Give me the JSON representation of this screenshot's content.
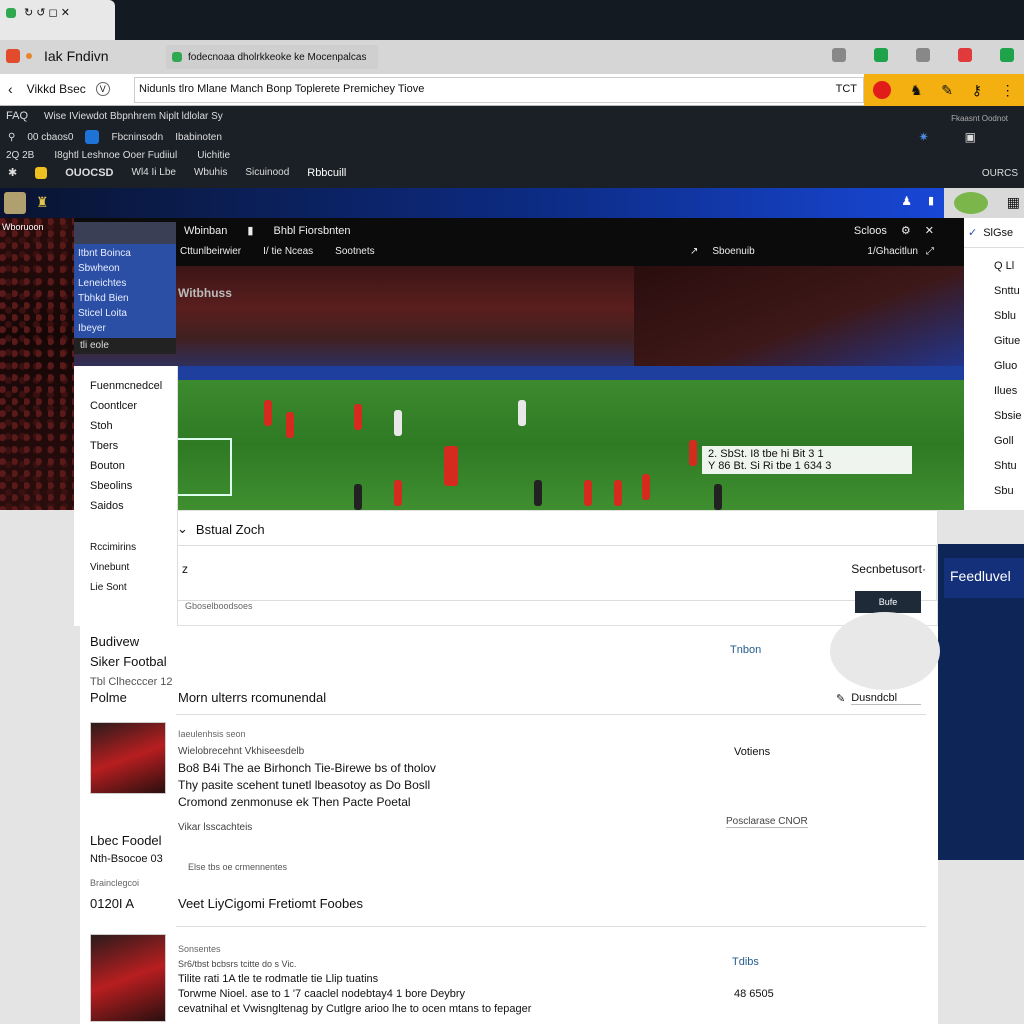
{
  "browser": {
    "active_tab_title": "Iak Fndivn",
    "bookmark_tab": "fodecnoaa dholrkkeoke ke Mocenpalcas",
    "address_left": "Vikkd Bsec",
    "url": "Nidunls tlro Mlane Manch Bonp Toplerete Premichey Tiove",
    "url_suffix": "TCT"
  },
  "site_nav": {
    "row1_label": "FAQ",
    "row1_text": "Wise IViewdot Bbpnhrem Niplt ldlolar Sy",
    "row2_left": "00 cbaos0",
    "row2_mid": "Fbcninsodn",
    "row2_right": "Ibabinoten",
    "row3_left": "2Q 2B",
    "row3_mid": "I8ghtl Leshnoe Ooer Fudiiul",
    "row3_right": "Uichitie",
    "row4_a": "OUOCSD",
    "row4_b": "Wl4 Ii Lbe",
    "row4_c": "Wbuhis",
    "row4_d": "Sicuinood",
    "row4_e": "Rbbcuill",
    "right_top": "Fkaasnt Oodnot",
    "right_bottom": "OURCS"
  },
  "video": {
    "left_label": "Wboruoon",
    "topbar_1": "Wbinban",
    "topbar_2": "Bhbl Fiorsbnten",
    "topbar_3": "Scloos",
    "topbar_sub1": "Cttunlbeirwier",
    "topbar_sub2": "I/ tie Nceas",
    "topbar_sub3": "Sootnets",
    "topbar_sub4": "Sboenuib",
    "topbar_sub5": "1/Ghacitlun",
    "stadium_text": "Witbhuss",
    "scoreboard_line1": "2. SbSt. I8 tbe hi Bit 3 1",
    "scoreboard_line2": "Y 86 Bt. Si Ri tbe 1 634  3"
  },
  "video_menu": {
    "items": [
      "Itbnt Boinca",
      "Sbwheon",
      "Leneichtes",
      "Tbhkd Bien",
      "Sticel Loita",
      "Ibeyer"
    ],
    "dark_label": "tli eole"
  },
  "dropdown": {
    "items": [
      "Fuenmcnedcel",
      "Coontlcer",
      "Stoh",
      "Tbers",
      "Bouton",
      "Sbeolins",
      "Saidos",
      "Rccimirins",
      "Vinebunt",
      "Lie Sont"
    ]
  },
  "right_col": {
    "header": "SlGse",
    "items": [
      "Q Ll",
      "Snttu",
      "Sblu",
      "Gitue",
      "Gluo",
      "Ilues",
      "Sbsie",
      "Goll",
      "Shtu",
      "Sbu"
    ]
  },
  "right_panel_label": "Feedluvel",
  "comment": {
    "header": "Bstual Zoch",
    "input_left": "z",
    "sort_label": "Secnbetusort·",
    "button_label": "Bufe",
    "footer_note": "Gboselboodsoes"
  },
  "feed": {
    "section1_a": "Budivew",
    "section1_b": "Siker Footbal",
    "section1_c": "Tbl  Clhecccer 12",
    "section1_right": "Tnbon",
    "row_left": "Polme",
    "row_headline": "Morn ulterrs rcomunendal",
    "row_right": "Dusndcbl",
    "article1_meta": "Iaeulenhsis seon",
    "article1_sub": "Wielobrecehnt Vkhiseesdelb",
    "article1_l1": "Bo8 B4i The ae Birhonch Tie-Birewe bs of tholov",
    "article1_l2": "Thy pasite scehent tunetl lbeasotoy as Do Bosll",
    "article1_l3": "Cromond zenmonuse ek Then Pacte Poetal",
    "article1_right": "Votiens",
    "article1_tag": "Vikar lsscachteis",
    "article1_tag_right": "Posclarase CNOR",
    "section2_a": "Lbec Foodel",
    "section2_b": "Nth-Bsocoe  03",
    "section2_c": "Brainclegcoi",
    "section2_meta": "Else tbs oe crmennentes",
    "row2_left": "0120I A",
    "row2_headline": "Veet LiyCigomi Fretiomt Foobes",
    "article2_meta": "Sonsentes",
    "article2_sub": "Sr6/tbst bcbsrs tcitte do s Vic.",
    "article2_l1": "Tilite rati 1A tle te rodmatle tie Llip tuatins",
    "article2_l2": "Torwme Nioel. ase to 1 '7 caaclel nodebtay4 1 bore Deybry",
    "article2_l3": "cevatnihal et Vwisngltenag by Cutlgre arioo lhe to ocen mtans to fepager",
    "article2_right": "Tdibs",
    "article2_right2": "48 6505"
  }
}
